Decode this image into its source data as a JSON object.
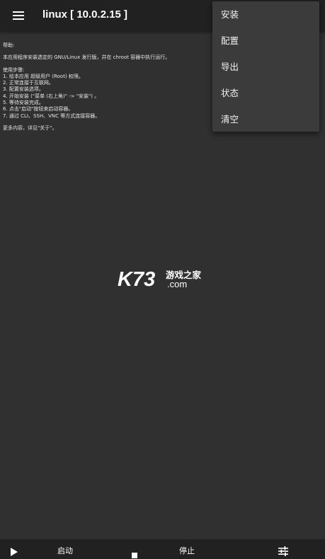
{
  "header": {
    "title": "linux [ 10.0.2.15 ]",
    "menu_icon": "hamburger-menu-icon"
  },
  "console": {
    "lines": [
      "帮助:",
      "",
      "本应用程序安装选定的 GNU/Linux 发行版，并在 chroot 容器中执行运行。",
      "",
      "使用步骤:",
      "1. 给本应用 超级用户 (Root) 权限。",
      "2. 正常连接于互联网。",
      "3. 配置安装选项。",
      "4. 开始安装 (\"菜单 (右上角)\" -> \"安装\") 。",
      "5. 等待安装完成。",
      "6. 点击\"启动\"按钮来启动容器。",
      "7. 通过 CLI、SSH、VNC 等方式连接容器。",
      "",
      "更多内容，详见\"关于\"。"
    ]
  },
  "watermark": {
    "brand": "K73",
    "cn": "游戏之家",
    "domain": ".com"
  },
  "overflow_menu": {
    "items": [
      "安装",
      "配置",
      "导出",
      "状态",
      "清空"
    ]
  },
  "bottom_bar": {
    "start_label": "启动",
    "start_icon": "play-icon",
    "stop_label": "停止",
    "stop_icon": "stop-icon",
    "settings_icon": "tune-sliders-icon"
  },
  "colors": {
    "background": "#303030",
    "appbar": "#212121",
    "menu": "#3b3b3b",
    "text": "#ffffff"
  }
}
